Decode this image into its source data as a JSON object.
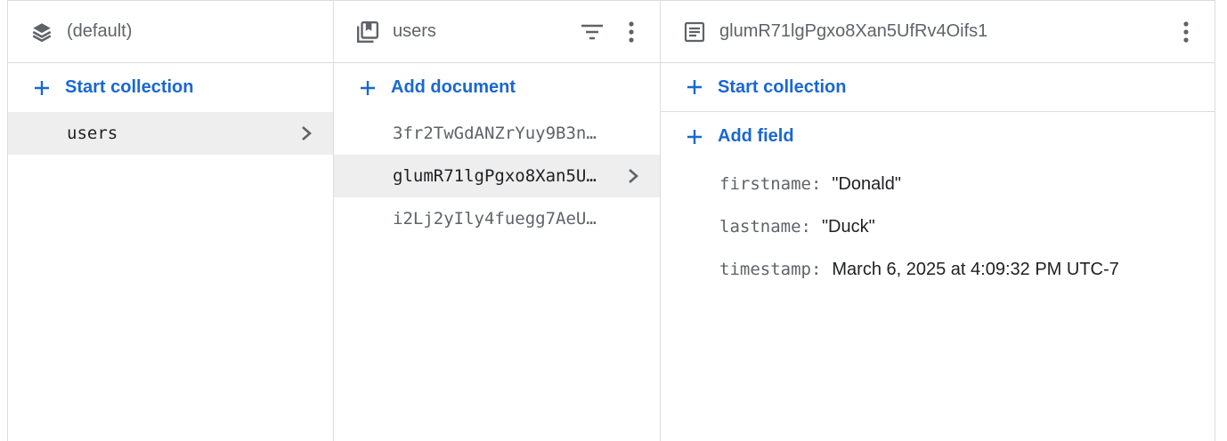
{
  "colors": {
    "accent": "#1967d2",
    "border": "#dadce0",
    "selected_bg": "#eeeeee",
    "muted_text": "#5f6368"
  },
  "panel_database": {
    "title": "(default)",
    "icon": "database-stack-icon",
    "action_label": "Start collection",
    "items": [
      {
        "label": "users",
        "selected": true
      }
    ]
  },
  "panel_collection": {
    "title": "users",
    "icon": "collection-icon",
    "filter_icon": "filter-icon",
    "more_icon": "more-vert-icon",
    "action_label": "Add document",
    "items": [
      {
        "label": "3fr2TwGdANZrYuy9B3n…",
        "selected": false
      },
      {
        "label": "glumR71lgPgxo8Xan5U…",
        "selected": true
      },
      {
        "label": "i2Lj2yIly4fuegg7AeU…",
        "selected": false
      }
    ]
  },
  "panel_document": {
    "title": "glumR71lgPgxo8Xan5UfRv4Oifs1",
    "icon": "document-icon",
    "more_icon": "more-vert-icon",
    "start_collection_label": "Start collection",
    "add_field_label": "Add field",
    "fields": [
      {
        "key": "firstname:",
        "value": "\"Donald\""
      },
      {
        "key": "lastname:",
        "value": "\"Duck\""
      },
      {
        "key": "timestamp:",
        "value": "March 6, 2025 at 4:09:32 PM UTC-7"
      }
    ]
  }
}
